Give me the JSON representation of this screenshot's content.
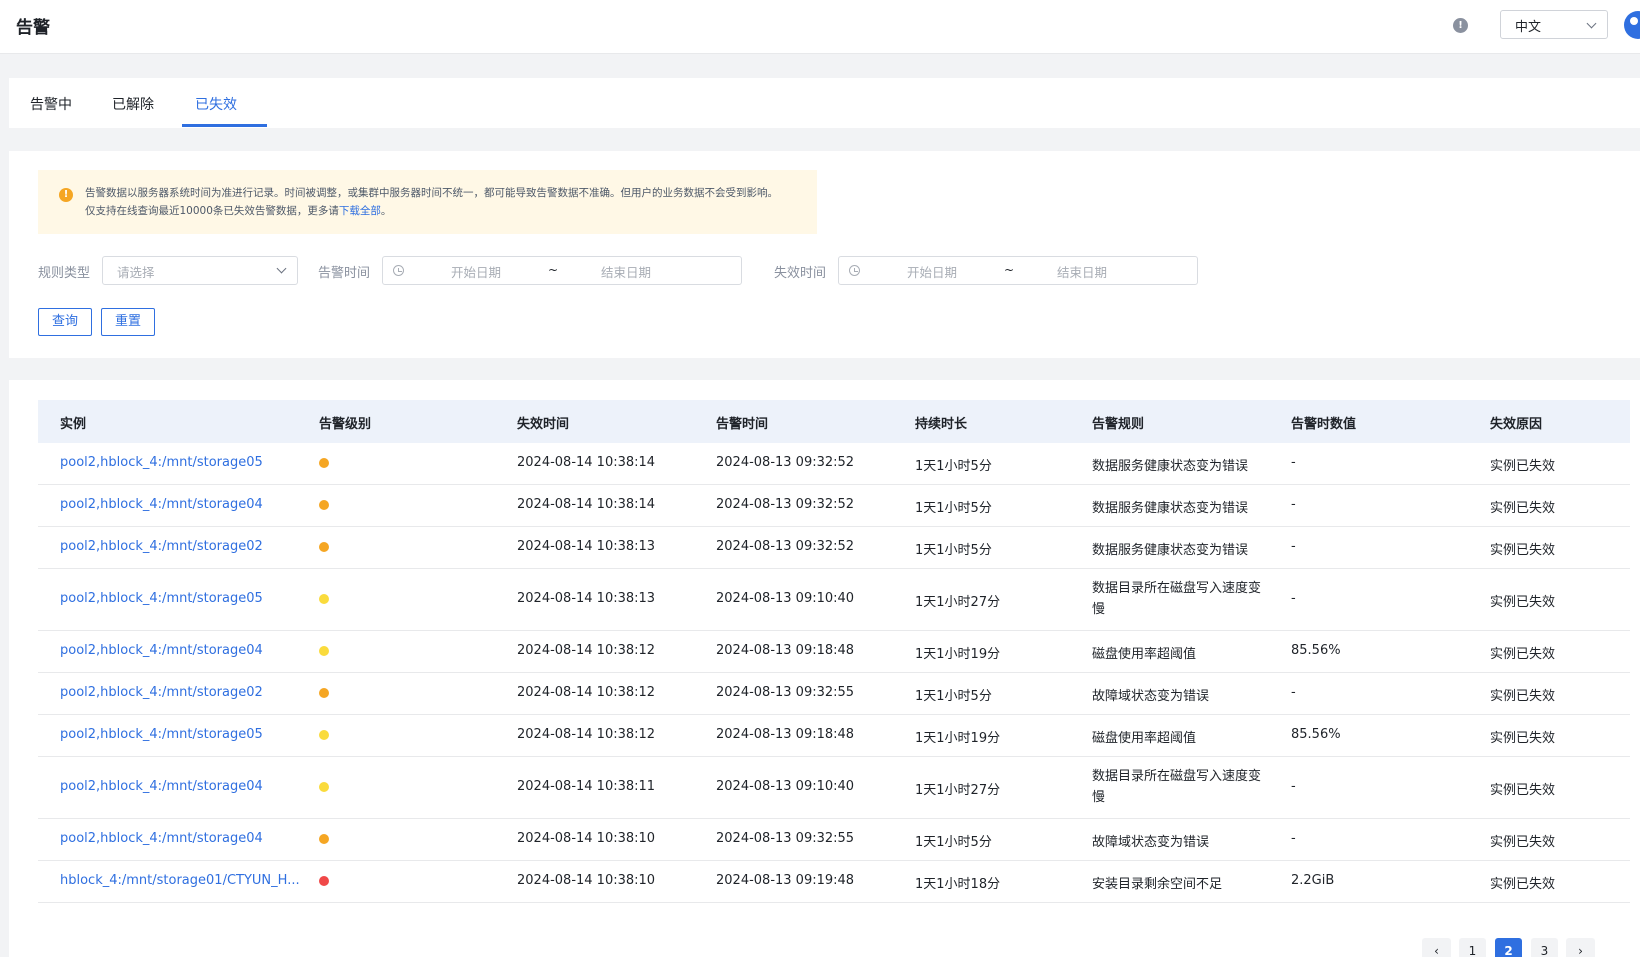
{
  "header": {
    "title": "告警",
    "language": "中文"
  },
  "tabs": [
    {
      "label": "告警中",
      "active": false
    },
    {
      "label": "已解除",
      "active": false
    },
    {
      "label": "已失效",
      "active": true
    }
  ],
  "notice": {
    "line1": "告警数据以服务器系统时间为准进行记录。时间被调整，或集群中服务器时间不统一，都可能导致告警数据不准确。但用户的业务数据不会受到影响。",
    "line2_prefix": "仅支持在线查询最近10000条已失效告警数据，更多请",
    "line2_link": "下载全部",
    "line2_suffix": "。"
  },
  "filters": {
    "rule_type_label": "规则类型",
    "rule_type_placeholder": "请选择",
    "alarm_time_label": "告警时间",
    "invalid_time_label": "失效时间",
    "start_placeholder": "开始日期",
    "end_placeholder": "结束日期",
    "range_sep": "~",
    "query_button": "查询",
    "reset_button": "重置"
  },
  "table": {
    "columns": [
      "实例",
      "告警级别",
      "失效时间",
      "告警时间",
      "持续时长",
      "告警规则",
      "告警时数值",
      "失效原因"
    ],
    "rows": [
      {
        "instance": "pool2,hblock_4:/mnt/storage05",
        "level_color": "#f5a623",
        "invalid_time": "2024-08-14 10:38:14",
        "alarm_time": "2024-08-13 09:32:52",
        "duration": "1天1小时5分",
        "rule": "数据服务健康状态变为错误",
        "value": "-",
        "reason": "实例已失效"
      },
      {
        "instance": "pool2,hblock_4:/mnt/storage04",
        "level_color": "#f5a623",
        "invalid_time": "2024-08-14 10:38:14",
        "alarm_time": "2024-08-13 09:32:52",
        "duration": "1天1小时5分",
        "rule": "数据服务健康状态变为错误",
        "value": "-",
        "reason": "实例已失效"
      },
      {
        "instance": "pool2,hblock_4:/mnt/storage02",
        "level_color": "#f5a623",
        "invalid_time": "2024-08-14 10:38:13",
        "alarm_time": "2024-08-13 09:32:52",
        "duration": "1天1小时5分",
        "rule": "数据服务健康状态变为错误",
        "value": "-",
        "reason": "实例已失效"
      },
      {
        "instance": "pool2,hblock_4:/mnt/storage05",
        "level_color": "#fadb3c",
        "invalid_time": "2024-08-14 10:38:13",
        "alarm_time": "2024-08-13 09:10:40",
        "duration": "1天1小时27分",
        "rule": "数据目录所在磁盘写入速度变慢",
        "value": "-",
        "reason": "实例已失效"
      },
      {
        "instance": "pool2,hblock_4:/mnt/storage04",
        "level_color": "#fadb3c",
        "invalid_time": "2024-08-14 10:38:12",
        "alarm_time": "2024-08-13 09:18:48",
        "duration": "1天1小时19分",
        "rule": "磁盘使用率超阈值",
        "value": "85.56%",
        "reason": "实例已失效"
      },
      {
        "instance": "pool2,hblock_4:/mnt/storage02",
        "level_color": "#f5a623",
        "invalid_time": "2024-08-14 10:38:12",
        "alarm_time": "2024-08-13 09:32:55",
        "duration": "1天1小时5分",
        "rule": "故障域状态变为错误",
        "value": "-",
        "reason": "实例已失效"
      },
      {
        "instance": "pool2,hblock_4:/mnt/storage05",
        "level_color": "#fadb3c",
        "invalid_time": "2024-08-14 10:38:12",
        "alarm_time": "2024-08-13 09:18:48",
        "duration": "1天1小时19分",
        "rule": "磁盘使用率超阈值",
        "value": "85.56%",
        "reason": "实例已失效"
      },
      {
        "instance": "pool2,hblock_4:/mnt/storage04",
        "level_color": "#fadb3c",
        "invalid_time": "2024-08-14 10:38:11",
        "alarm_time": "2024-08-13 09:10:40",
        "duration": "1天1小时27分",
        "rule": "数据目录所在磁盘写入速度变慢",
        "value": "-",
        "reason": "实例已失效"
      },
      {
        "instance": "pool2,hblock_4:/mnt/storage04",
        "level_color": "#f5a623",
        "invalid_time": "2024-08-14 10:38:10",
        "alarm_time": "2024-08-13 09:32:55",
        "duration": "1天1小时5分",
        "rule": "故障域状态变为错误",
        "value": "-",
        "reason": "实例已失效"
      },
      {
        "instance": "hblock_4:/mnt/storage01/CTYUN_H...",
        "level_color": "#f04848",
        "invalid_time": "2024-08-14 10:38:10",
        "alarm_time": "2024-08-13 09:19:48",
        "duration": "1天1小时18分",
        "rule": "安装目录剩余空间不足",
        "value": "2.2GiB",
        "reason": "实例已失效"
      }
    ]
  },
  "pagination": {
    "prev": "‹",
    "pages": [
      "1",
      "2",
      "3"
    ],
    "current": "2",
    "next": "›"
  }
}
